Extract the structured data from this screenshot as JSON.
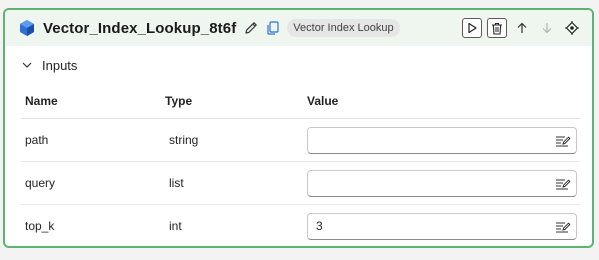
{
  "node": {
    "title": "Vector_Index_Lookup_8t6f",
    "badge": "Vector Index Lookup",
    "icons": {
      "title": "vector-index-icon",
      "edit": "pencil-icon",
      "copy": "copy-icon",
      "run": "play-icon",
      "delete": "trash-icon",
      "up": "arrow-up-icon",
      "down": "arrow-down-icon",
      "locate": "locate-icon"
    },
    "accent": "#5db36f"
  },
  "inputs": {
    "section_label": "Inputs",
    "columns": [
      "Name",
      "Type",
      "Value"
    ],
    "rows": [
      {
        "name": "path",
        "type": "string",
        "value": ""
      },
      {
        "name": "query",
        "type": "list",
        "value": ""
      },
      {
        "name": "top_k",
        "type": "int",
        "value": "3"
      }
    ]
  }
}
